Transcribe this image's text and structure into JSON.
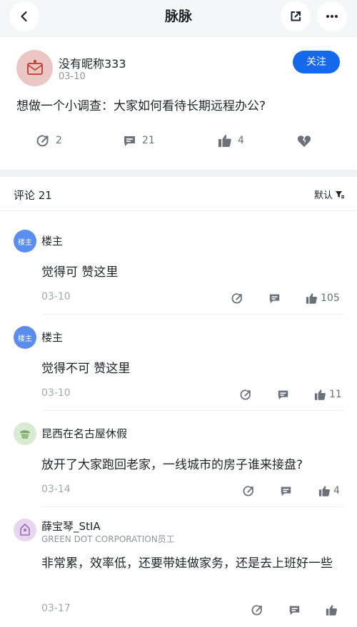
{
  "nav": {
    "title": "脉脉"
  },
  "post": {
    "author": "没有昵称333",
    "date": "03-10",
    "follow_label": "关注",
    "question": "想做一个小调查：大家如何看待长期远程办公?",
    "forward_count": "2",
    "comment_count": "21",
    "like_count": "4"
  },
  "comments_header": {
    "title": "评论 21",
    "sort_label": "默认"
  },
  "comments": [
    {
      "avatar_text": "楼主",
      "avatar_color": "#5b8def",
      "name": "楼主",
      "subtitle": "",
      "text": "觉得可 赞这里",
      "date": "03-10",
      "likes": "105"
    },
    {
      "avatar_text": "楼主",
      "avatar_color": "#5b8def",
      "name": "楼主",
      "subtitle": "",
      "text": "觉得不可 赞这里",
      "date": "03-10",
      "likes": "11"
    },
    {
      "avatar_text": "",
      "avatar_color": "#d9ead3",
      "name": "昆西在名古屋休假",
      "subtitle": "",
      "text": "放开了大家跑回老家，一线城市的房子谁来接盘?",
      "date": "03-14",
      "likes": "4"
    },
    {
      "avatar_text": "",
      "avatar_color": "#e8d5ef",
      "name": "薛宝琴_StIA",
      "subtitle": "GREEN DOT CORPORATION员工",
      "text": "非常累，效率低，还要带娃做家务，还是去上班好一些",
      "date": "03-17",
      "likes": ""
    }
  ]
}
